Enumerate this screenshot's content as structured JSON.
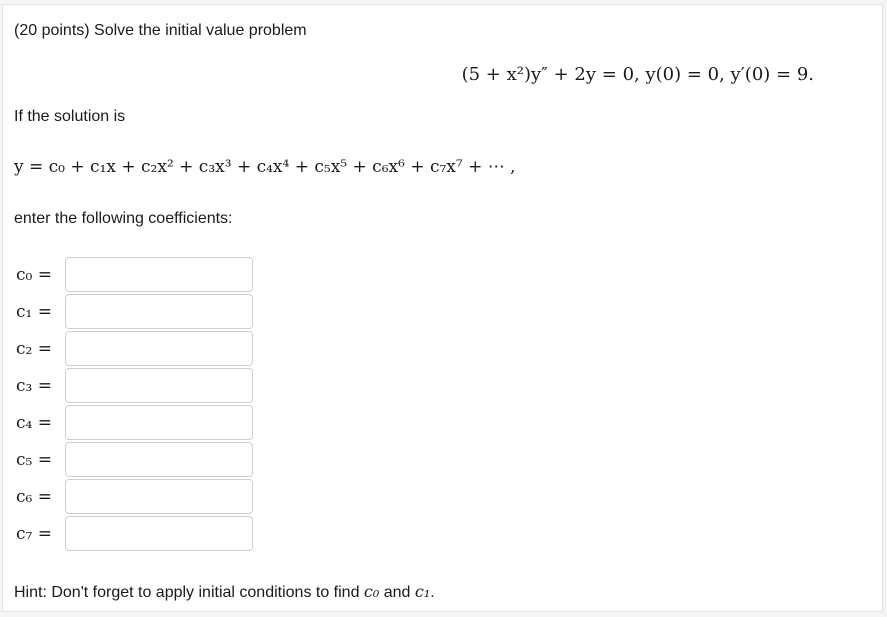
{
  "problem": {
    "prompt": "(20 points) Solve the initial value problem",
    "equation": "(5 + x²)y″ + 2y = 0,  y(0) = 0,  y′(0) = 9.",
    "if_solution": "If the solution is",
    "series": "y = c₀ + c₁x + c₂x² + c₃x³ + c₄x⁴ + c₅x⁵ + c₆x⁶ + c₇x⁷ + ⋯ ,",
    "enter_text": "enter the following coefficients:"
  },
  "coefficients": [
    {
      "label": "c₀ =",
      "value": ""
    },
    {
      "label": "c₁ =",
      "value": ""
    },
    {
      "label": "c₂ =",
      "value": ""
    },
    {
      "label": "c₃ =",
      "value": ""
    },
    {
      "label": "c₄ =",
      "value": ""
    },
    {
      "label": "c₅ =",
      "value": ""
    },
    {
      "label": "c₆ =",
      "value": ""
    },
    {
      "label": "c₇ =",
      "value": ""
    }
  ],
  "hint": {
    "text": "Hint: Don't forget to apply initial conditions to find",
    "var_a": "c₀",
    "conj": "and",
    "var_b": "c₁",
    "end": "."
  }
}
